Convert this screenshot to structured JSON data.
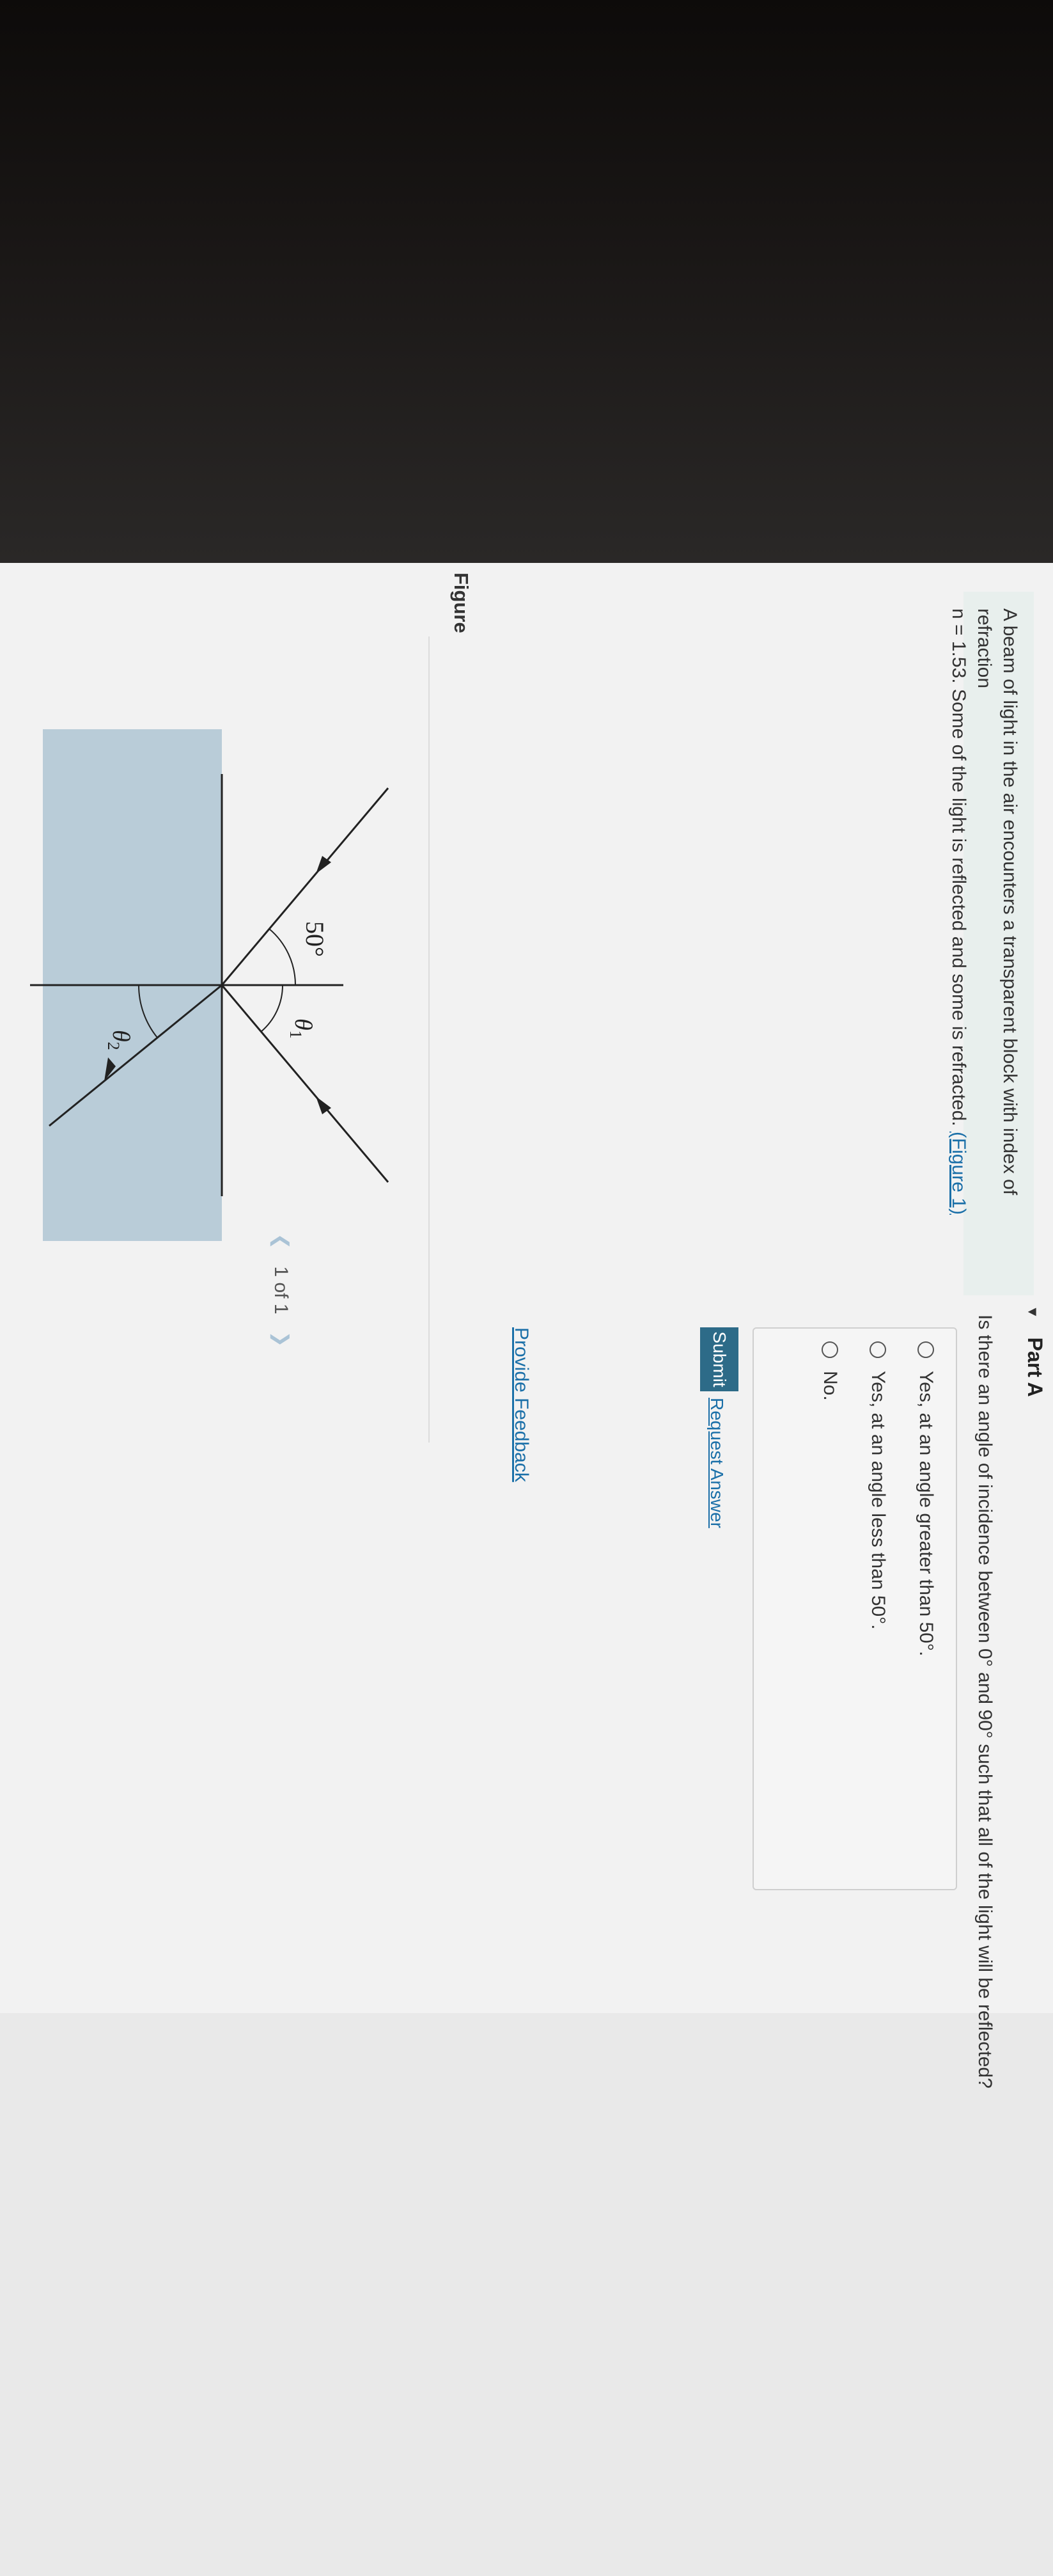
{
  "problem": {
    "intro_line1": "A beam of light in the air encounters a transparent block with index of refraction",
    "intro_line2": "n = 1.53. Some of the light is reflected and some is refracted.",
    "figure_link": "(Figure 1)"
  },
  "figure": {
    "title": "Figure",
    "pager": {
      "prev_icon": "chevron-left-icon",
      "label": "1 of 1",
      "next_icon": "chevron-right-icon"
    },
    "diagram": {
      "incident_angle_label": "50°",
      "angle1_label": "θ",
      "angle1_sub": "1",
      "angle2_label": "θ",
      "angle2_sub": "2"
    }
  },
  "part_a": {
    "title": "Part A",
    "question": "Is there an angle of incidence between 0° and 90° such that all of the light will be reflected?",
    "options": [
      "Yes, at an angle greater than 50°.",
      "Yes, at an angle less than 50°.",
      "No."
    ],
    "submit_label": "Submit",
    "request_answer_label": "Request Answer"
  },
  "feedback_label": "Provide Feedback",
  "colors": {
    "block": "#b9ccd8",
    "link": "#1a6fa8",
    "submit": "#2d6b88"
  }
}
